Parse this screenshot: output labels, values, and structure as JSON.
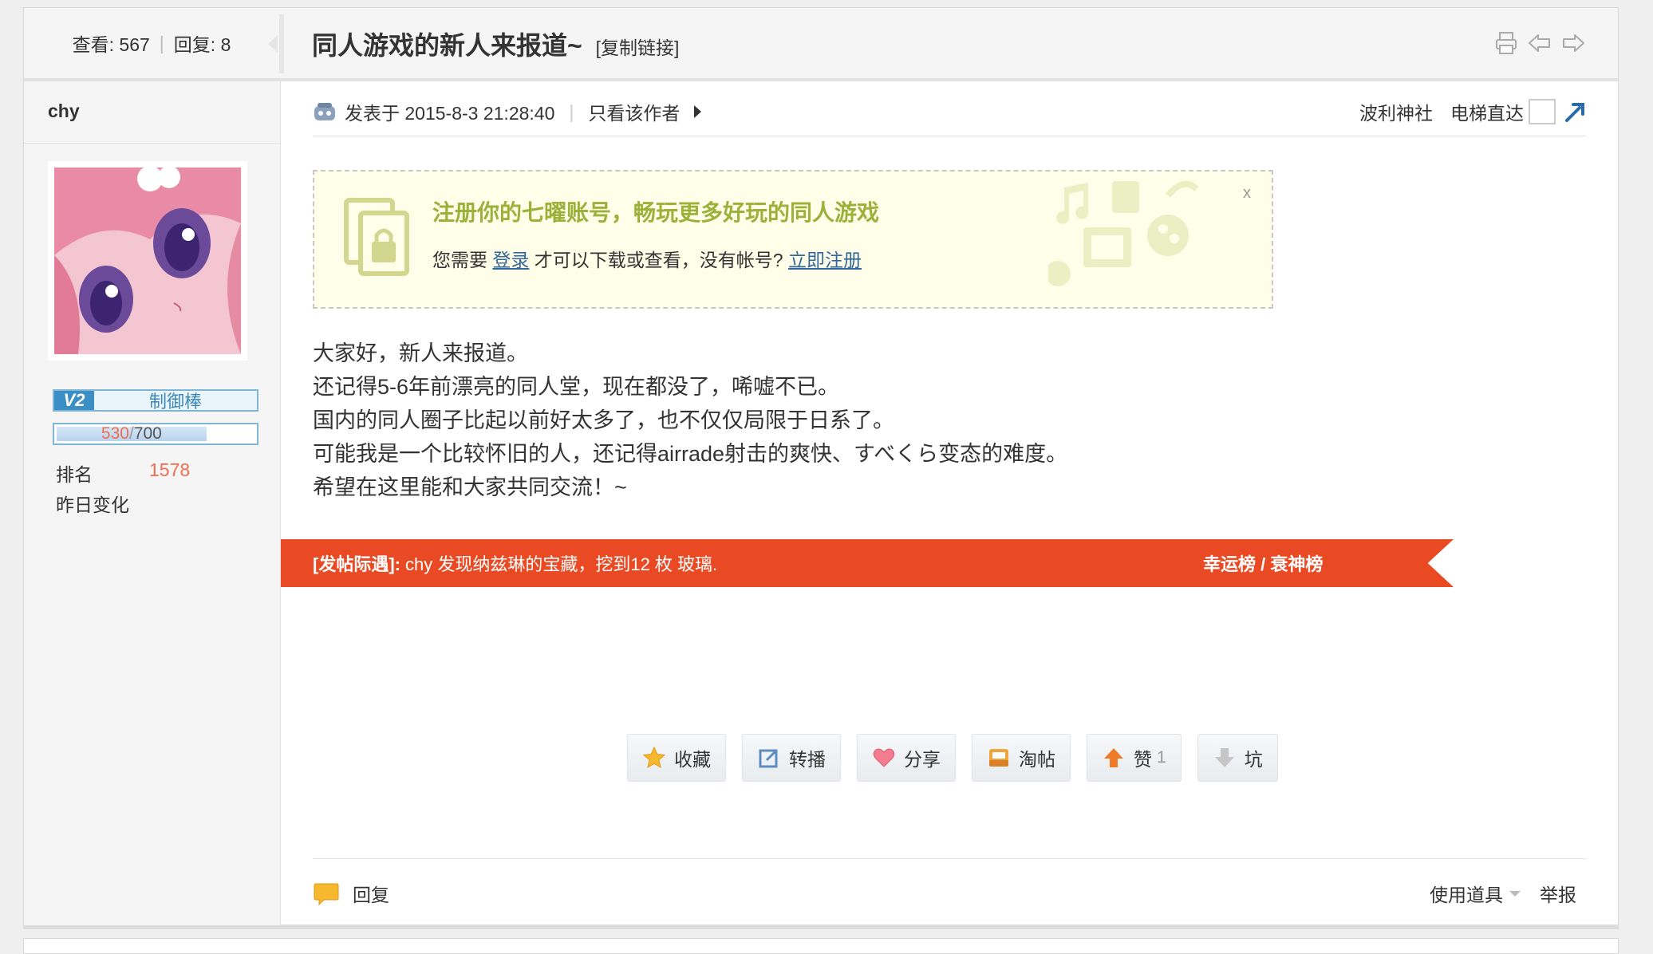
{
  "header": {
    "views_label": "查看:",
    "views": "567",
    "replies_label": "回复:",
    "replies": "8",
    "title": "同人游戏的新人来报道~",
    "copy_link": "[复制链接]",
    "icons": [
      "print-icon",
      "prev-thread-icon",
      "next-thread-icon"
    ]
  },
  "author": {
    "name": "chy",
    "level_badge": "V2",
    "level_title": "制御棒",
    "exp_current": "530",
    "exp_sep": "/",
    "exp_max": "700",
    "exp_fraction": 0.757,
    "rank_label": "排名",
    "rank_value": "1578",
    "change_label": "昨日变化"
  },
  "post": {
    "posted_label": "发表于 2015-8-3 21:28:40",
    "only_author": "只看该作者",
    "board_link": "波利神社",
    "elevator": "电梯直达",
    "notice": {
      "title": "注册你的七曜账号，畅玩更多好玩的同人游戏",
      "prefix": "您需要",
      "login": "登录",
      "middle": "才可以下载或查看，没有帐号?",
      "register": "立即注册",
      "close": "x"
    },
    "content": [
      "大家好，新人来报道。",
      "还记得5-6年前漂亮的同人堂，现在都没了，唏嘘不已。",
      "国内的同人圈子比起以前好太多了，也不仅仅局限于日系了。",
      "可能我是一个比较怀旧的人，还记得airrade射击的爽快、すべくら变态的难度。",
      "希望在这里能和大家共同交流！~"
    ],
    "banner": {
      "tag": "[发帖际遇]:",
      "text": "chy 发现纳兹琳的宝藏，挖到12 枚 玻璃.",
      "link": "幸运榜 / 衰神榜",
      "color": "#ea4a23"
    },
    "actions": {
      "favorite": "收藏",
      "repost": "转播",
      "share": "分享",
      "tao": "淘帖",
      "like": "赞",
      "like_count": "1",
      "dislike": "坑"
    },
    "footer": {
      "reply": "回复",
      "tools": "使用道具",
      "report": "举报"
    }
  }
}
